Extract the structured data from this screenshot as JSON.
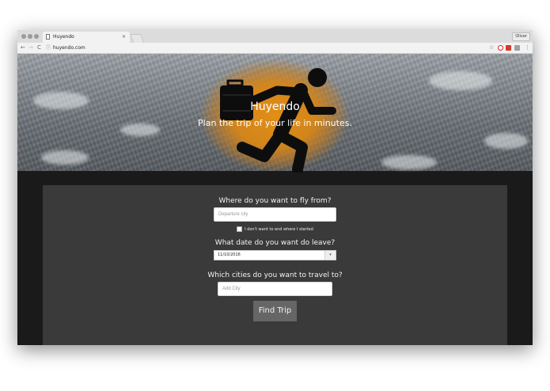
{
  "browser": {
    "tab_title": "Huyendo",
    "tab_close": "×",
    "profile_name": "Oliver",
    "url": "huyendo.com",
    "nav_icons": {
      "back": "←",
      "forward": "→",
      "reload": "C",
      "info": "ⓘ",
      "star": "☆",
      "menu": "⋮"
    }
  },
  "hero": {
    "title": "Huyendo",
    "subtitle": "Plan the trip of your life in minutes.",
    "accent_color": "#e08e16"
  },
  "form": {
    "from_question": "Where do you want to fly from?",
    "departure_placeholder": "Departure city",
    "checkbox_label": "I don't want to end where I started",
    "date_question": "What date do you want do leave?",
    "date_value": "11/10/2016",
    "date_picker_glyph": "▾",
    "cities_question": "Which cities do you want to travel to?",
    "add_city_placeholder": "Add City",
    "submit_label": "Find Trip"
  }
}
